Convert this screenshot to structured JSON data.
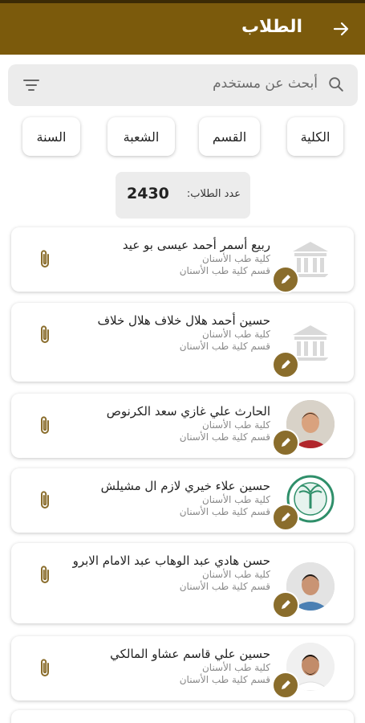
{
  "header": {
    "title": "الطلاب",
    "back_icon": "arrow-right-icon",
    "bg": "#7b5a0c"
  },
  "search": {
    "placeholder": "أبحث عن مستخدم"
  },
  "filters": {
    "college": "الكلية",
    "department": "القسم",
    "section": "الشعبة",
    "year": "السنة"
  },
  "count": {
    "label": "عدد الطلاب:",
    "value": "2430"
  },
  "students": [
    {
      "name": "ربيع أسمر أحمد عيسى بو عيد",
      "college": "كلية طب الأسنان",
      "department": "قسم كلية طب الأسنان",
      "avatar": "building"
    },
    {
      "name": "حسين أحمد هلال خلاف هلال خلاف",
      "college": "كلية طب الأسنان",
      "department": "قسم كلية طب الأسنان",
      "avatar": "building"
    },
    {
      "name": "الحارث علي غازي سعد الكرنوص",
      "college": "كلية طب الأسنان",
      "department": "قسم كلية طب الأسنان",
      "avatar": "photo-red"
    },
    {
      "name": "حسين علاء خيري لازم ال مشيلش",
      "college": "كلية طب الأسنان",
      "department": "قسم كلية طب الأسنان",
      "avatar": "emblem"
    },
    {
      "name": "حسن هادي عبد الوهاب عبد الامام الابرو",
      "college": "كلية طب الأسنان",
      "department": "قسم كلية طب الأسنان",
      "avatar": "photo-blue"
    },
    {
      "name": "حسين علي قاسم عشاو المالكي",
      "college": "كلية طب الأسنان",
      "department": "قسم كلية طب الأسنان",
      "avatar": "photo-white"
    }
  ]
}
